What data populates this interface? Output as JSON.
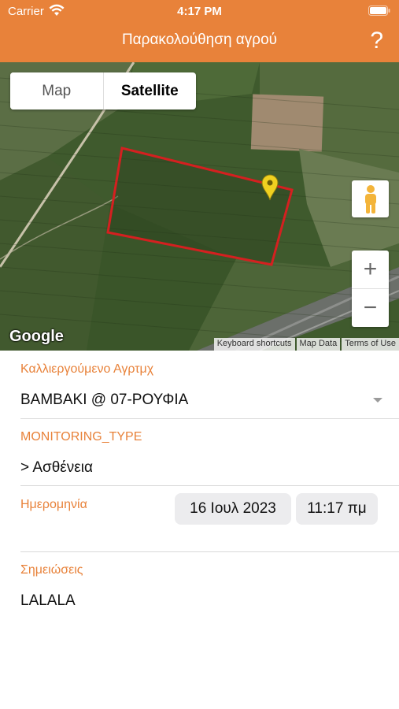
{
  "status_bar": {
    "carrier": "Carrier",
    "time": "4:17 PM"
  },
  "nav": {
    "title": "Παρακολούθηση αγρού",
    "help_label": "?"
  },
  "map": {
    "type_options": [
      "Map",
      "Satellite"
    ],
    "selected_type": "Satellite",
    "zoom_in_label": "+",
    "zoom_out_label": "−",
    "logo_text": "Google",
    "attribution": [
      "Keyboard shortcuts",
      "Map Data",
      "Terms of Use"
    ],
    "colors": {
      "field_outline": "#d42020",
      "marker": "#f0d020",
      "satellite_base": "#3e5a2c"
    }
  },
  "form": {
    "field_label": "Καλλιεργούμενο Αγρτμχ",
    "field_value": "ΒΑΜΒΑΚΙ @ 07-ΡΟΥΦΙΑ",
    "monitoring_label": "MONITORING_TYPE",
    "monitoring_value": "> Ασθένεια",
    "date_label": "Ημερομηνία",
    "date_value": "16 Ιουλ 2023",
    "time_value": "11:17 πμ",
    "notes_label": "Σημειώσεις",
    "notes_value": "LALALA"
  },
  "theme": {
    "accent": "#e8823a"
  }
}
